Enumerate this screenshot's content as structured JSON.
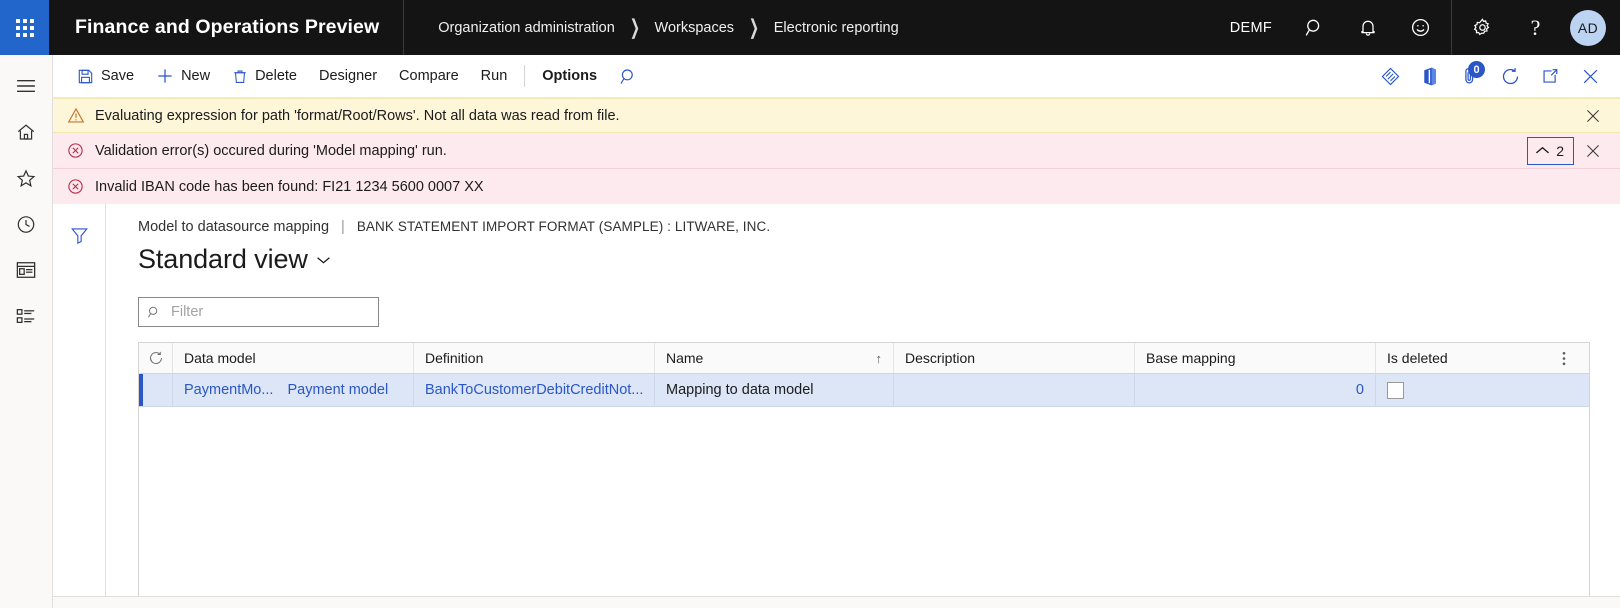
{
  "topbar": {
    "waffle_icon": "app-launcher-icon",
    "brand": "Finance and Operations Preview",
    "breadcrumb": [
      "Organization administration",
      "Workspaces",
      "Electronic reporting"
    ],
    "company": "DEMF",
    "icons": [
      "search-icon",
      "notifications-bell-icon",
      "feedback-smiley-icon",
      "settings-gear-icon",
      "help-question-icon"
    ],
    "avatar_initials": "AD"
  },
  "rail": {
    "items": [
      "hamburger-menu-icon",
      "home-icon",
      "favorites-star-icon",
      "recent-clock-icon",
      "workspaces-icon",
      "modules-list-icon"
    ]
  },
  "commandbar": {
    "save_label": "Save",
    "new_label": "New",
    "delete_label": "Delete",
    "designer_label": "Designer",
    "compare_label": "Compare",
    "run_label": "Run",
    "options_label": "Options",
    "search_icon": "search-icon",
    "right_icons": [
      "personalize-diamond-icon",
      "office-app-icon",
      "attachments-icon",
      "refresh-circle-icon",
      "open-in-new-window-icon",
      "close-icon"
    ],
    "attachment_badge": "0"
  },
  "messages": {
    "warning": {
      "text": "Evaluating expression for path 'format/Root/Rows'.   Not all data was read from file.",
      "icon": "warning-triangle-icon",
      "close_icon": "close-icon"
    },
    "error": {
      "text": "Validation error(s) occured during 'Model mapping' run.",
      "icon": "error-circle-icon",
      "collapse_count": "2",
      "collapse_chevron": "chevron-up-icon",
      "close_icon": "close-icon"
    },
    "error_detail": {
      "text": "Invalid IBAN code has been found: FI21 1234 5600 0007 XX",
      "icon": "error-circle-icon"
    }
  },
  "content": {
    "filter_rail_icon": "filter-funnel-icon",
    "caption_main": "Model to datasource mapping",
    "caption_separator": "|",
    "caption_sub": "BANK STATEMENT IMPORT FORMAT (SAMPLE) : LITWARE, INC.",
    "page_title": "Standard view",
    "page_title_chevron": "chevron-down-icon",
    "filter": {
      "placeholder": "Filter",
      "value": "",
      "icon": "search-icon"
    },
    "grid": {
      "refresh_icon": "refresh-icon",
      "options_icon": "column-options-ellipsis-icon",
      "columns": [
        {
          "label": "Data model",
          "sorted": false
        },
        {
          "label": "Definition",
          "sorted": false
        },
        {
          "label": "Name",
          "sorted": true,
          "sort_arrow": "↑"
        },
        {
          "label": "Description",
          "sorted": false
        },
        {
          "label": "Base mapping",
          "sorted": false
        },
        {
          "label": "Is deleted",
          "sorted": false
        }
      ],
      "rows": [
        {
          "data_model_code": "PaymentMo...",
          "data_model_name": "Payment model",
          "definition": "BankToCustomerDebitCreditNot...",
          "name": "Mapping to data model",
          "description": "",
          "base_mapping": "0",
          "is_deleted": false
        }
      ]
    }
  }
}
